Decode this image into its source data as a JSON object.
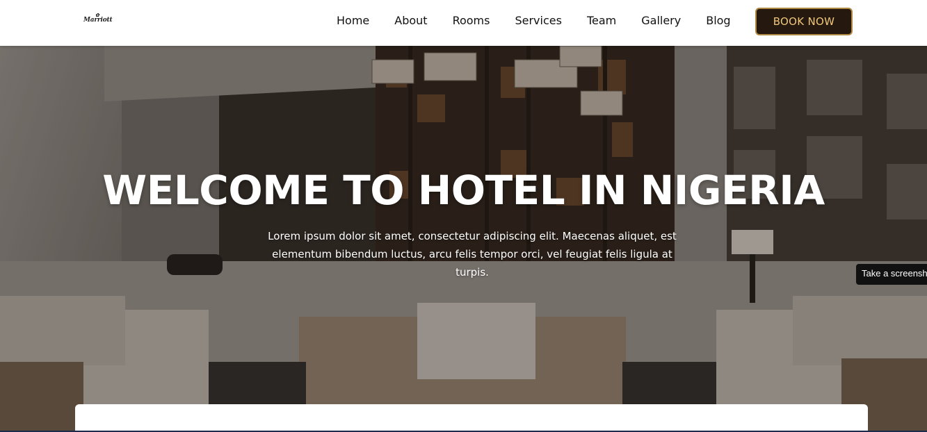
{
  "header": {
    "logo_text": "Marriott",
    "nav": [
      "Home",
      "About",
      "Rooms",
      "Services",
      "Team",
      "Gallery",
      "Blog"
    ],
    "book_label": "BOOK NOW"
  },
  "hero": {
    "title": "WELCOME TO HOTEL IN NIGERIA",
    "text": "Lorem ipsum dolor sit amet, consectetur adipiscing elit. Maecenas aliquet, est elementum bibendum luctus, arcu felis tempor orci, vel feugiat felis ligula at turpis."
  },
  "tooltip": "Take a screenshot",
  "colors": {
    "book_bg": "#24180f",
    "book_border": "#b08a43",
    "book_text": "#f0c77b"
  }
}
